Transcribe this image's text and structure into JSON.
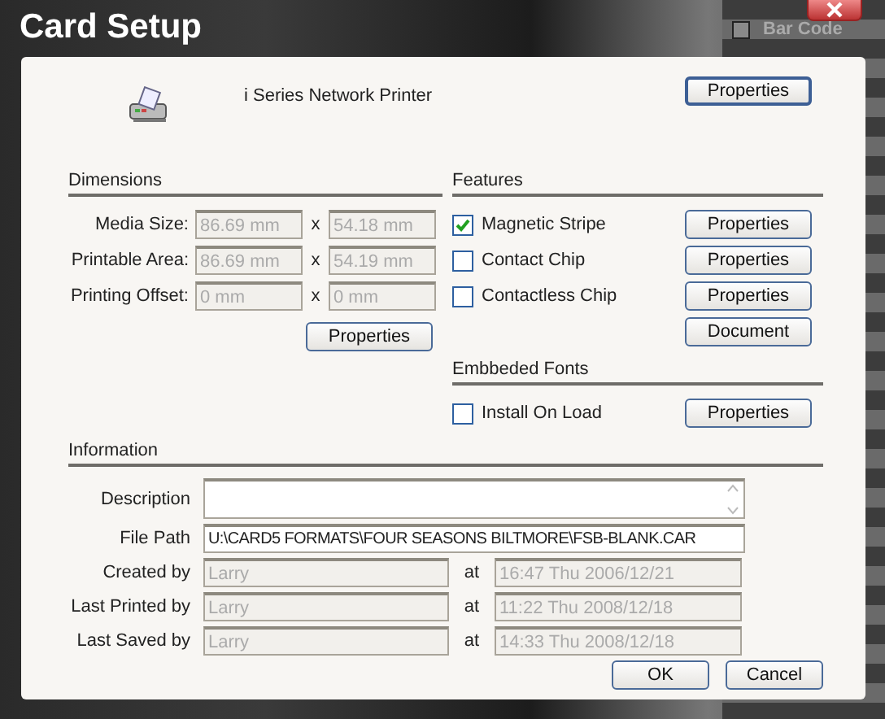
{
  "window": {
    "title": "Card Setup"
  },
  "background_panel": {
    "items": [
      "Bar Code"
    ]
  },
  "printer": {
    "name": "i Series Network Printer",
    "button": "Properties"
  },
  "dimensions": {
    "title": "Dimensions",
    "rows": [
      {
        "label": "Media Size:",
        "width": "86.69 mm",
        "separator": "x",
        "height": "54.18 mm",
        "disabled": true
      },
      {
        "label": "Printable Area:",
        "width": "86.69 mm",
        "separator": "x",
        "height": "54.19 mm",
        "disabled": true
      },
      {
        "label": "Printing Offset:",
        "width": "0 mm",
        "separator": "x",
        "height": "0 mm",
        "disabled": true
      }
    ],
    "button": "Properties"
  },
  "features": {
    "title": "Features",
    "items": [
      {
        "label": "Magnetic Stripe",
        "checked": true,
        "button": "Properties"
      },
      {
        "label": "Contact Chip",
        "checked": false,
        "button": "Properties"
      },
      {
        "label": "Contactless Chip",
        "checked": false,
        "button": "Properties"
      }
    ],
    "extra_button": "Document"
  },
  "embedded_fonts": {
    "title": "Embbeded Fonts",
    "items": [
      {
        "label": "Install On Load",
        "checked": false,
        "button": "Properties"
      }
    ]
  },
  "information": {
    "title": "Information",
    "description": {
      "label": "Description"
    },
    "file_path": {
      "label": "File Path",
      "value": "U:\\CARD5 FORMATS\\FOUR SEASONS BILTMORE\\FSB-BLANK.CAR"
    },
    "records": [
      {
        "label": "Created by",
        "user": "Larry",
        "at": "at",
        "time": "16:47 Thu 2006/12/21",
        "disabled": true
      },
      {
        "label": "Last Printed by",
        "user": "Larry",
        "at": "at",
        "time": "11:22 Thu 2008/12/18",
        "disabled": true
      },
      {
        "label": "Last Saved by",
        "user": "Larry",
        "at": "at",
        "time": "14:33 Thu 2008/12/18",
        "disabled": true
      }
    ]
  },
  "buttons": [
    {
      "label": "OK"
    },
    {
      "label": "Cancel"
    }
  ]
}
